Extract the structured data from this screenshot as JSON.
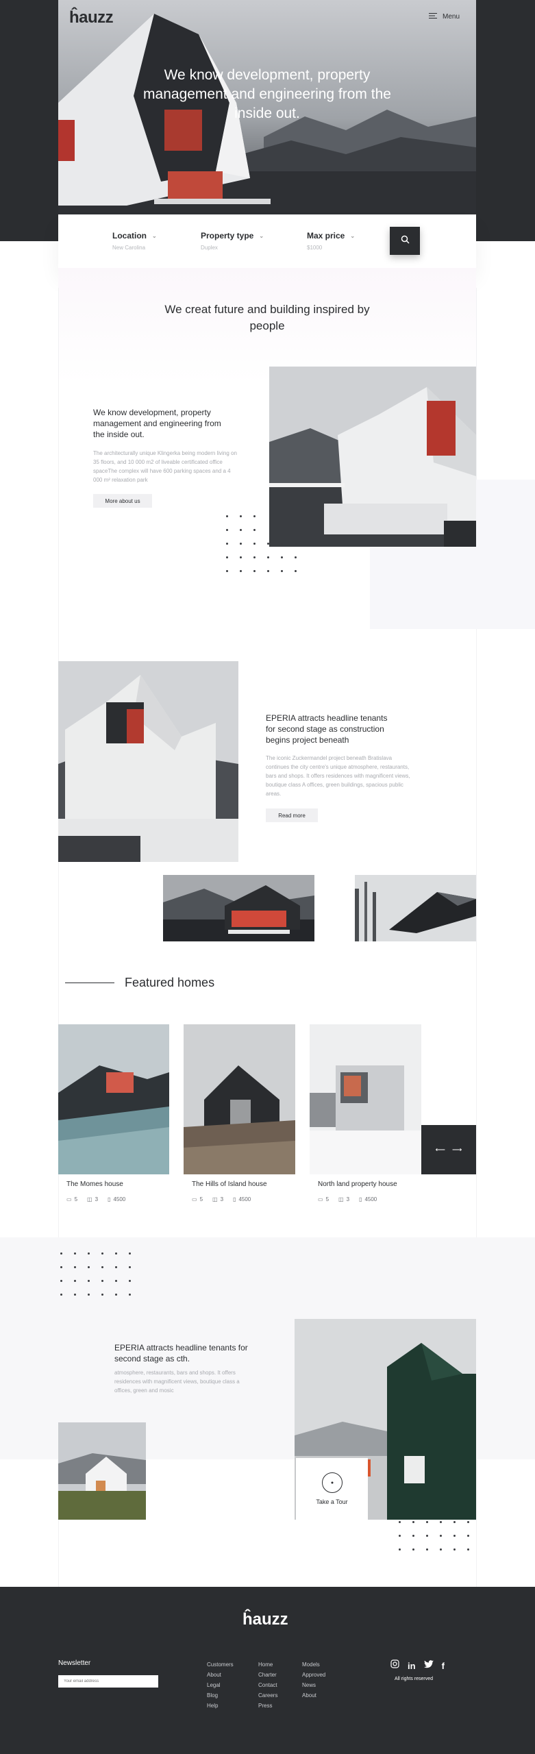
{
  "brand": {
    "logo": "ĥauzz"
  },
  "header": {
    "menu_label": "Menu"
  },
  "hero": {
    "title": "We know development, property management and engineering from the inside out."
  },
  "search": {
    "fields": [
      {
        "label": "Location",
        "value": "New Carolina"
      },
      {
        "label": "Property type",
        "value": "Duplex"
      },
      {
        "label": "Max price",
        "value": "$1000"
      }
    ]
  },
  "mission": {
    "title": "We creat future  and building inspired by people"
  },
  "about": {
    "title": "We know development, property management and engineering from the inside out.",
    "text": "The architecturally unique Klingerka being modern living on 35 floors, and 10 000 m2 of liveable certificated office spaceThe complex will have 600 parking spaces and a 4 000 m² relaxation park",
    "button": "More about us"
  },
  "news": {
    "title": "EPERIA attracts headline tenants for second stage as construction begins project beneath",
    "text": "The iconic Zuckermandel project beneath Bratislava continues the city centre's unique atmosphere, restaurants, bars and shops. It offers residences with magnificent views, boutique class A offices, green buildings, spacious public areas.",
    "button": "Read more"
  },
  "featured": {
    "title": "Featured homes",
    "homes": [
      {
        "name": "The Momes house",
        "beds": "5",
        "baths": "3",
        "area": "4500"
      },
      {
        "name": "The Hills of Island house",
        "beds": "5",
        "baths": "3",
        "area": "4500"
      },
      {
        "name": "North land property house",
        "beds": "5",
        "baths": "3",
        "area": "4500"
      }
    ]
  },
  "story": {
    "title": "EPERIA attracts headline tenants for second stage as cth.",
    "text": "atmosphere, restaurants, bars and shops. It offers residences with magnificent views, boutique class a offices, green and mosic"
  },
  "tour": {
    "label": "Take a Tour"
  },
  "footer": {
    "logo": "ĥauzz",
    "newsletter_title": "Newsletter",
    "newsletter_placeholder": "Your email address",
    "col1": [
      "Customers",
      "About",
      "Legal",
      "Blog",
      "Help"
    ],
    "col2": [
      "Home",
      "Charter",
      "Contact",
      "Careers",
      "Press"
    ],
    "col3": [
      "Models",
      "Approved",
      "News",
      "About"
    ],
    "social_icons": [
      "instagram-icon",
      "linkedin-icon",
      "twitter-icon",
      "facebook-icon"
    ],
    "rights": "All rights reserved"
  },
  "colors": {
    "dark": "#2b2d30",
    "accent_red": "#c0392b",
    "grey_bg": "#f7f7f9"
  }
}
